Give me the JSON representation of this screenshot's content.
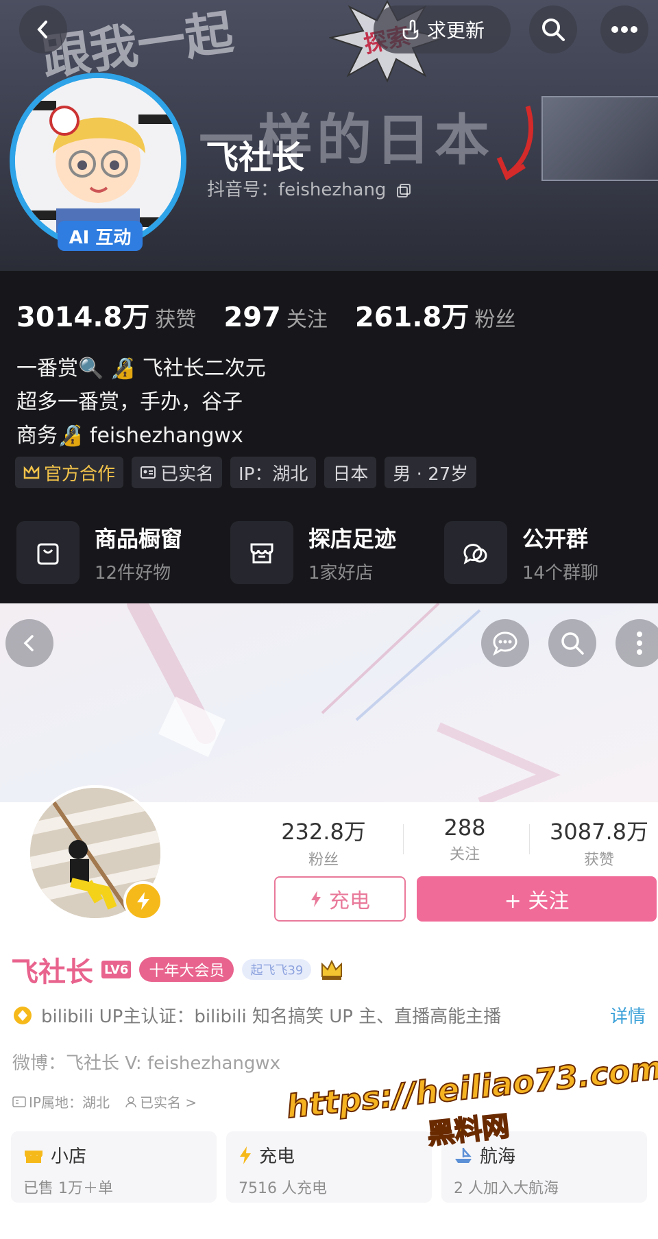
{
  "douyin": {
    "banner": {
      "bg_text_1": "跟我一起",
      "bg_text_2": "一样的日本",
      "burst_text": "探索"
    },
    "update_button": {
      "label": "求更新"
    },
    "avatar_badge": "AI 互动",
    "name": "飞社长",
    "handle": "抖音号：feishezhang",
    "stats": [
      {
        "value": "3014.8万",
        "label": "获赞"
      },
      {
        "value": "297",
        "label": "关注"
      },
      {
        "value": "261.8万",
        "label": "粉丝"
      }
    ],
    "bio": [
      "一番赏🔍 🔏 飞社长二次元",
      "超多一番赏，手办，谷子",
      "商务🔏 feishezhangwx"
    ],
    "tags": [
      {
        "label": "官方合作",
        "icon": "crown-icon"
      },
      {
        "label": "已实名",
        "icon": "id-card-icon"
      },
      {
        "label": "IP：湖北"
      },
      {
        "label": "日本"
      },
      {
        "label": "男 · 27岁"
      }
    ],
    "entries": [
      {
        "title": "商品橱窗",
        "sub": "12件好物",
        "icon": "bag-icon"
      },
      {
        "title": "探店足迹",
        "sub": "1家好店",
        "icon": "store-icon"
      },
      {
        "title": "公开群",
        "sub": "14个群聊",
        "icon": "chat-group-icon"
      }
    ]
  },
  "bilibili": {
    "stats": [
      {
        "value": "232.8万",
        "label": "粉丝"
      },
      {
        "value": "288",
        "label": "关注"
      },
      {
        "value": "3087.8万",
        "label": "获赞"
      }
    ],
    "charge_button": "充电",
    "follow_button": "+ 关注",
    "name": "飞社长",
    "level": "LV6",
    "vip": "十年大会员",
    "medal": "起飞飞39",
    "verify": {
      "text": "bilibili UP主认证：bilibili 知名搞笑 UP 主、直播高能主播",
      "more": "详情"
    },
    "weibo": "微博：飞社长  V: feishezhangwx",
    "ip": {
      "location": "IP属地：湖北",
      "realname": "已实名 >"
    },
    "cards": [
      {
        "title": "小店",
        "sub": "已售 1万＋单",
        "icon": "shop-icon"
      },
      {
        "title": "充电",
        "sub": "7516 人充电",
        "icon": "lightning-icon"
      },
      {
        "title": "航海",
        "sub": "2 人加入大航海",
        "icon": "ship-icon"
      }
    ]
  },
  "watermark": {
    "url": "https://heiliao73.com",
    "name": "黑料网"
  },
  "colors": {
    "douyin_bg": "#17171b",
    "bilibili_pink": "#f06b97",
    "official_gold": "#f1c24a",
    "watermark_gold": "#f5b321"
  }
}
